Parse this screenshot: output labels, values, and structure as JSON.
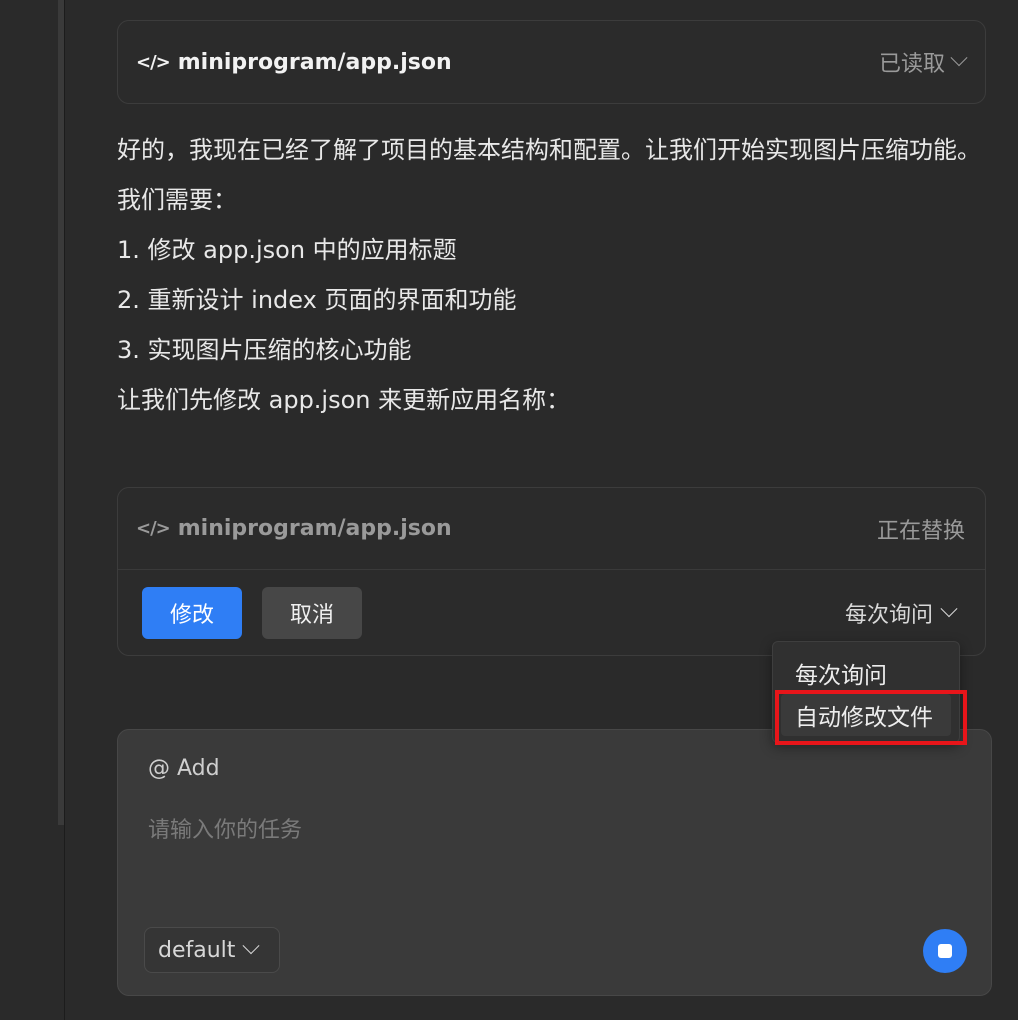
{
  "read_card": {
    "icon": "</>",
    "path": "miniprogram/app.json",
    "status": "已读取"
  },
  "message": {
    "lines": [
      "好的，我现在已经了解了项目的基本结构和配置。让我们开始实现图片压缩功能。",
      "我们需要：",
      "1. 修改 app.json 中的应用标题",
      "2. 重新设计 index 页面的界面和功能",
      "3. 实现图片压缩的核心功能",
      "让我们先修改 app.json 来更新应用名称："
    ]
  },
  "edit_card": {
    "icon": "</>",
    "path": "miniprogram/app.json",
    "status": "正在替换",
    "apply_label": "修改",
    "cancel_label": "取消",
    "mode_label": "每次询问"
  },
  "mode_dropdown": {
    "options": [
      "每次询问",
      "自动修改文件"
    ]
  },
  "composer": {
    "add_label": "@ Add",
    "placeholder": "请输入你的任务",
    "model_label": "default"
  },
  "colors": {
    "accent": "#2f7ef5",
    "highlight_box": "#e8151a"
  }
}
